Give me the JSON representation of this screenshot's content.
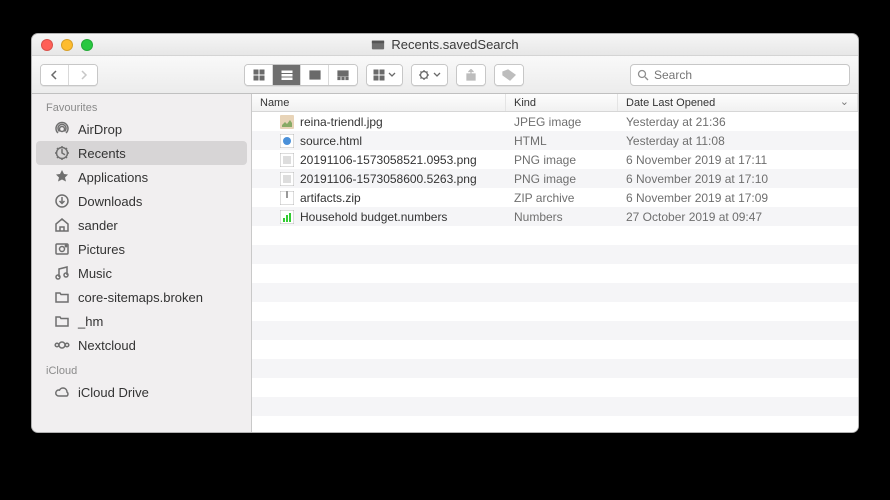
{
  "window": {
    "title": "Recents.savedSearch"
  },
  "toolbar": {
    "search_placeholder": "Search"
  },
  "sidebar": {
    "sections": [
      {
        "label": "Favourites",
        "items": [
          {
            "icon": "airdrop",
            "label": "AirDrop"
          },
          {
            "icon": "recents",
            "label": "Recents",
            "selected": true
          },
          {
            "icon": "apps",
            "label": "Applications"
          },
          {
            "icon": "downloads",
            "label": "Downloads"
          },
          {
            "icon": "home",
            "label": "sander"
          },
          {
            "icon": "pictures",
            "label": "Pictures"
          },
          {
            "icon": "music",
            "label": "Music"
          },
          {
            "icon": "folder",
            "label": "core-sitemaps.broken"
          },
          {
            "icon": "folder",
            "label": "_hm"
          },
          {
            "icon": "nextcloud",
            "label": "Nextcloud"
          }
        ]
      },
      {
        "label": "iCloud",
        "items": [
          {
            "icon": "cloud",
            "label": "iCloud Drive"
          }
        ]
      }
    ]
  },
  "columns": {
    "name": "Name",
    "kind": "Kind",
    "date": "Date Last Opened"
  },
  "files": [
    {
      "icon": "jpg",
      "name": "reina-triendl.jpg",
      "kind": "JPEG image",
      "date": "Yesterday at 21:36"
    },
    {
      "icon": "html",
      "name": "source.html",
      "kind": "HTML",
      "date": "Yesterday at 11:08"
    },
    {
      "icon": "png",
      "name": "20191106-1573058521.0953.png",
      "kind": "PNG image",
      "date": "6 November 2019 at 17:11"
    },
    {
      "icon": "png",
      "name": "20191106-1573058600.5263.png",
      "kind": "PNG image",
      "date": "6 November 2019 at 17:10"
    },
    {
      "icon": "zip",
      "name": "artifacts.zip",
      "kind": "ZIP archive",
      "date": "6 November 2019 at 17:09"
    },
    {
      "icon": "numbers",
      "name": "Household budget.numbers",
      "kind": "Numbers",
      "date": "27 October 2019 at 09:47"
    }
  ]
}
